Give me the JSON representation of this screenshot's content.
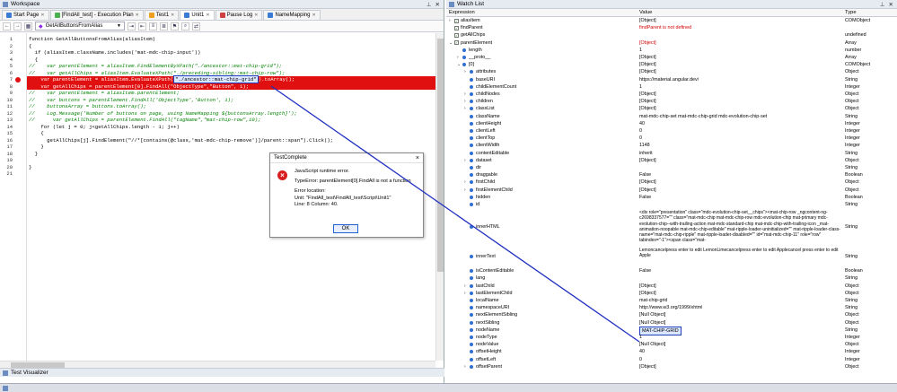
{
  "workspace": {
    "title": "Workspace",
    "tabs": [
      {
        "label": "Start Page",
        "color": "#3a7bd5"
      },
      {
        "label": "[FindAll_test] - Execution Plan",
        "color": "#4caf50"
      },
      {
        "label": "Test1",
        "color": "#f0a020"
      },
      {
        "label": "Unit1",
        "color": "#3a7bd5"
      },
      {
        "label": "Pause Log",
        "color": "#d04040"
      },
      {
        "label": "NameMapping",
        "color": "#3a7bd5"
      }
    ],
    "routine_dropdown": "GetAllButtonsFromAlias"
  },
  "code": {
    "line_numbers": [
      "1",
      "2",
      "3",
      "4",
      "5",
      "6",
      "7",
      "8",
      "9",
      "10",
      "11",
      "12",
      "13",
      "14",
      "15",
      "16",
      "17",
      "18",
      "19",
      "20",
      "21"
    ],
    "lines": [
      "function GetAllButtonsFromAlias(aliasItem)",
      "{",
      "  if (aliasItem.className.includes('mat-mdc-chip-input'))",
      "  {",
      "//    var parentElement = aliasItem.FindElementByXPath(\"./ancestor::mat-chip-grid\");",
      "//    var getAllChips = aliasItem.EvaluateXPath(\"./preceding-sibling::mat-chip-row\");",
      "    var parentElement = aliasItem.EvaluateXPath(\"./ancestor::mat-chip-grid\").toArray();",
      "    var getAllChips = parentElement[0].FindAll(\"ObjectType\",\"Button\", 1);",
      "//    var parentElement = aliasItem.parentElement;",
      "//    var buttons = parentElement.FindAll('ObjectType','Button', 1);",
      "//    buttonsArray = buttons.toArray();",
      "//    Log.Message('Number of buttons on page, using NameMapping ${buttonsArray.length}');",
      "//      var getAllChips = parentElement.FindAll(\"tagName\",\"mat-chip-row\",10);",
      "    for (let j = 0; j<getAllChips.length - 1; j++)",
      "    {",
      "      getAllChips[j].FindElement(\"//*[contains(@class,'mat-mdc-chip-remove')]/parent::span\").Click();",
      "    }",
      "  }",
      "",
      "}",
      ""
    ],
    "selected_text": "\"./ancestor::mat-chip-grid\""
  },
  "dialog": {
    "title": "TestComplete",
    "close": "×",
    "icon": "×",
    "message": "JavaScript runtime error.",
    "detail": "TypeError: parentElement[0].FindAll is not a function",
    "location_label": "Error location:",
    "location_unit": "Unit: \"FindAll_test\\FindAll_test\\Script\\Unit1\"",
    "location_line": "Line: 8 Column: 40.",
    "ok": "OK"
  },
  "test_visualizer": "Test Visualizer",
  "watch": {
    "title": "Watch List",
    "columns": {
      "expression": "Expression",
      "value": "Value",
      "type": "Type"
    },
    "rows": [
      {
        "expr": "aliasItem",
        "value": "[Object]",
        "type": "COMObject",
        "indent": 0,
        "chev": "›",
        "cb": "✓"
      },
      {
        "expr": "findParent",
        "value": "findParent is not defined",
        "type": "",
        "indent": 0,
        "chev": "",
        "cb": "✓",
        "red": true
      },
      {
        "expr": "getAllChips",
        "value": "",
        "type": "undefined",
        "indent": 0,
        "chev": "",
        "cb": "✓"
      },
      {
        "expr": "parentElement",
        "value": "[Object]",
        "type": "Array",
        "indent": 0,
        "chev": "⌄",
        "cb": "✓",
        "red": true
      },
      {
        "expr": "length",
        "value": "1",
        "type": "number",
        "indent": 1,
        "chev": "",
        "dot": true
      },
      {
        "expr": "__proto__",
        "value": "[Object]",
        "type": "Array",
        "indent": 1,
        "chev": "›",
        "dot": true
      },
      {
        "expr": "[0]",
        "value": "[Object]",
        "type": "COMObject",
        "indent": 1,
        "chev": "⌄",
        "dot": true
      },
      {
        "expr": "attributes",
        "value": "[Object]",
        "type": "Object",
        "indent": 2,
        "chev": "›",
        "dot": true
      },
      {
        "expr": "baseURI",
        "value": "https://material.angular.dev/",
        "type": "String",
        "indent": 2,
        "chev": "",
        "dot": true
      },
      {
        "expr": "childElementCount",
        "value": "1",
        "type": "Integer",
        "indent": 2,
        "chev": "",
        "dot": true
      },
      {
        "expr": "childNodes",
        "value": "[Object]",
        "type": "Object",
        "indent": 2,
        "chev": "›",
        "dot": true
      },
      {
        "expr": "children",
        "value": "[Object]",
        "type": "Object",
        "indent": 2,
        "chev": "›",
        "dot": true
      },
      {
        "expr": "classList",
        "value": "[Object]",
        "type": "Object",
        "indent": 2,
        "chev": "›",
        "dot": true
      },
      {
        "expr": "className",
        "value": "mat-mdc-chip-set mat-mdc-chip-grid mdc-evolution-chip-set",
        "type": "String",
        "indent": 2,
        "chev": "",
        "dot": true
      },
      {
        "expr": "clientHeight",
        "value": "40",
        "type": "Integer",
        "indent": 2,
        "chev": "",
        "dot": true
      },
      {
        "expr": "clientLeft",
        "value": "0",
        "type": "Integer",
        "indent": 2,
        "chev": "",
        "dot": true
      },
      {
        "expr": "clientTop",
        "value": "0",
        "type": "Integer",
        "indent": 2,
        "chev": "",
        "dot": true
      },
      {
        "expr": "clientWidth",
        "value": "1148",
        "type": "Integer",
        "indent": 2,
        "chev": "",
        "dot": true
      },
      {
        "expr": "contentEditable",
        "value": "inherit",
        "type": "String",
        "indent": 2,
        "chev": "",
        "dot": true
      },
      {
        "expr": "dataset",
        "value": "[Object]",
        "type": "Object",
        "indent": 2,
        "chev": "›",
        "dot": true
      },
      {
        "expr": "dir",
        "value": "",
        "type": "String",
        "indent": 2,
        "chev": "",
        "dot": true
      },
      {
        "expr": "draggable",
        "value": "False",
        "type": "Boolean",
        "indent": 2,
        "chev": "",
        "dot": true
      },
      {
        "expr": "firstChild",
        "value": "[Object]",
        "type": "Object",
        "indent": 2,
        "chev": "›",
        "dot": true
      },
      {
        "expr": "firstElementChild",
        "value": "[Object]",
        "type": "Object",
        "indent": 2,
        "chev": "›",
        "dot": true
      },
      {
        "expr": "hidden",
        "value": "False",
        "type": "Boolean",
        "indent": 2,
        "chev": "",
        "dot": true
      },
      {
        "expr": "id",
        "value": "",
        "type": "String",
        "indent": 2,
        "chev": "",
        "dot": true
      }
    ],
    "innerHTML": {
      "expr": "innerHTML",
      "type": "String",
      "value": "<div role=\"presentation\" class=\"mdc-evolution-chip-set__chips\"><mat-chip-row _ngcontent-ng-c2698337577=\"\" class=\"mat-mdc-chip mat-mdc-chip-row mdc-evolution-chip mat-primary mdc-evolution-chip--with-trailing-action mat-mdc-standard-chip mat-mdc-chip-with-trailing-icon _mat-animation-noopable mat-mdc-chip-editable\" mat-ripple-loader-uninitialized=\"\" mat-ripple-loader-class-name=\"mat-mdc-chip-ripple\" mat-ripple-loader-disabled=\"\" id=\"mat-mdc-chip-11\" role=\"row\" tabindex=\"-1\"><span class=\"mat-"
    },
    "innerText": {
      "expr": "innerText",
      "type": "String",
      "value": "Lemoncancelpress enter to edit LemonLimecancelpress enter to edit Applecancel press enter to edit Apple"
    },
    "rows2": [
      {
        "expr": "isContentEditable",
        "value": "False",
        "type": "Boolean",
        "indent": 2,
        "chev": "",
        "dot": true
      },
      {
        "expr": "lang",
        "value": "",
        "type": "String",
        "indent": 2,
        "chev": "",
        "dot": true
      },
      {
        "expr": "lastChild",
        "value": "[Object]",
        "type": "Object",
        "indent": 2,
        "chev": "›",
        "dot": true
      },
      {
        "expr": "lastElementChild",
        "value": "[Object]",
        "type": "Object",
        "indent": 2,
        "chev": "›",
        "dot": true
      },
      {
        "expr": "localName",
        "value": "mat-chip-grid",
        "type": "String",
        "indent": 2,
        "chev": "",
        "dot": true
      },
      {
        "expr": "namespaceURI",
        "value": "http://www.w3.org/1999/xhtml",
        "type": "String",
        "indent": 2,
        "chev": "",
        "dot": true
      },
      {
        "expr": "nextElementSibling",
        "value": "[Null Object]",
        "type": "Object",
        "indent": 2,
        "chev": "",
        "dot": true
      },
      {
        "expr": "nextSibling",
        "value": "[Null Object]",
        "type": "Object",
        "indent": 2,
        "chev": "",
        "dot": true
      },
      {
        "expr": "nodeName",
        "value": "MAT-CHIP-GRID",
        "type": "String",
        "indent": 2,
        "chev": "",
        "dot": true,
        "hl": true
      },
      {
        "expr": "nodeType",
        "value": "1",
        "type": "Integer",
        "indent": 2,
        "chev": "",
        "dot": true
      },
      {
        "expr": "nodeValue",
        "value": "[Null Object]",
        "type": "Object",
        "indent": 2,
        "chev": "",
        "dot": true
      },
      {
        "expr": "offsetHeight",
        "value": "40",
        "type": "Integer",
        "indent": 2,
        "chev": "",
        "dot": true
      },
      {
        "expr": "offsetLeft",
        "value": "0",
        "type": "Integer",
        "indent": 2,
        "chev": "",
        "dot": true
      },
      {
        "expr": "offsetParent",
        "value": "[Object]",
        "type": "Object",
        "indent": 2,
        "chev": "›",
        "dot": true
      }
    ]
  }
}
